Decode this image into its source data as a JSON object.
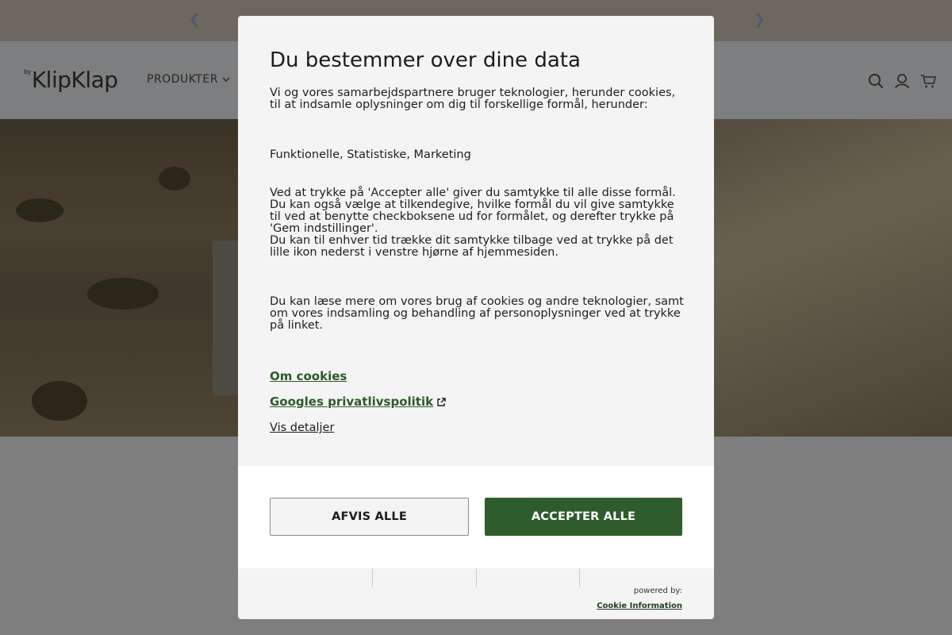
{
  "header": {
    "logo_prefix": "by",
    "logo": "KlipKlap",
    "nav_item": "PRODUKTER"
  },
  "icons": [
    "chevron-left-icon",
    "chevron-right-icon",
    "chevron-down-icon",
    "search-icon",
    "user-icon",
    "cart-icon",
    "external-link-icon"
  ],
  "colors": {
    "accent": "#2f5c2c",
    "link": "#2d5a2a",
    "modal_bg": "#f4f4f4",
    "overlay": "#7f7e7e"
  },
  "consent": {
    "title": "Du bestemmer over dine data",
    "intro": "Vi og vores samarbejdspartnere bruger teknologier, herunder cookies, til at indsamle oplysninger om dig til forskellige formål, herunder:",
    "purposes": "Funktionelle, Statistiske, Marketing",
    "info_1": "Ved at trykke på 'Accepter alle' giver du samtykke til alle disse formål.",
    "info_2": "Du kan også vælge at tilkendegive, hvilke formål du vil give samtykke til ved at benytte checkboksene ud for formålet, og derefter trykke på 'Gem indstillinger'.",
    "info_3": "Du kan til enhver tid trække dit samtykke tilbage ved at trykke på det lille ikon nederst i venstre hjørne af hjemmesiden.",
    "read_more": "Du kan læse mere om vores brug af cookies og andre teknologier, samt om vores indsamling og behandling af personoplysninger ved at trykke på linket.",
    "link_cookies": "Om cookies",
    "link_google": "Googles privatlivspolitik",
    "link_details": "Vis detaljer",
    "reject_label": "AFVIS ALLE",
    "accept_label": "ACCEPTER ALLE",
    "powered_by": "powered by:",
    "provider": "Cookie Information"
  }
}
